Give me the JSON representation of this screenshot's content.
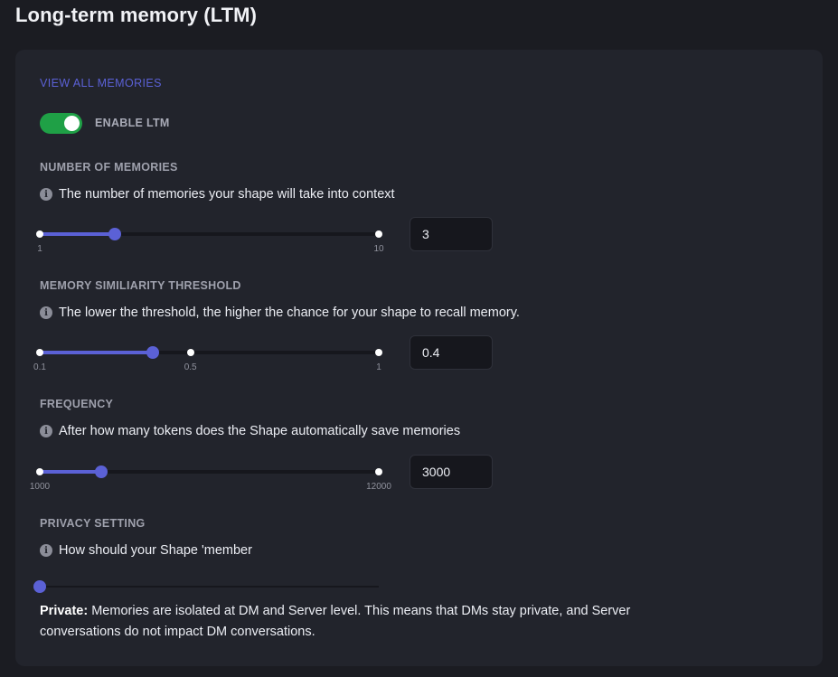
{
  "page": {
    "title": "Long-term memory (LTM)"
  },
  "ltm": {
    "view_all_label": "VIEW ALL MEMORIES",
    "enable_label": "ENABLE LTM",
    "enabled": true
  },
  "memories": {
    "title": "NUMBER OF MEMORIES",
    "description": "The number of memories your shape will take into context",
    "min_label": "1",
    "max_label": "10",
    "min": 1,
    "max": 10,
    "value": 3,
    "input_value": "3"
  },
  "threshold": {
    "title": "MEMORY SIMILIARITY THRESHOLD",
    "description": "The lower the threshold, the higher the chance for your shape to recall memory.",
    "min_label": "0.1",
    "mid_label": "0.5",
    "max_label": "1",
    "min": 0.1,
    "mid": 0.5,
    "max": 1,
    "value": 0.4,
    "input_value": "0.4"
  },
  "frequency": {
    "title": "FREQUENCY",
    "description": "After how many tokens does the Shape automatically save memories",
    "min_label": "1000",
    "max_label": "12000",
    "min": 1000,
    "max": 12000,
    "value": 3000,
    "input_value": "3000"
  },
  "privacy": {
    "title": "PRIVACY SETTING",
    "description": "How should your Shape 'member",
    "value_position": 0,
    "mode_label": "Private:",
    "mode_text": " Memories are isolated at DM and Server level. This means that DMs stay private, and Server conversations do not impact DM conversations."
  },
  "colors": {
    "accent": "#5b61d6",
    "toggle_on": "#1fa046",
    "panel": "#22242c",
    "background": "#1b1c22"
  },
  "icons": {
    "info": "info-icon"
  }
}
